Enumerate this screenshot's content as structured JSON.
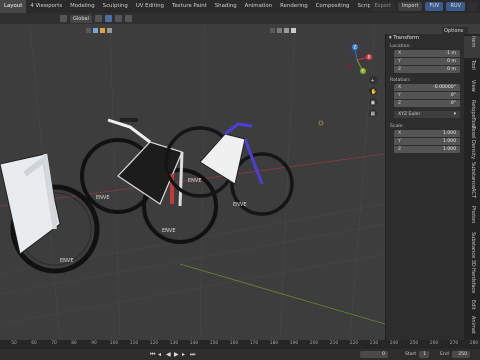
{
  "workspace_tabs": [
    {
      "label": "Layout",
      "active": true
    },
    {
      "label": "4 Viewports",
      "active": false
    },
    {
      "label": "Modeling",
      "active": false
    },
    {
      "label": "Sculpting",
      "active": false
    },
    {
      "label": "UV Editing",
      "active": false
    },
    {
      "label": "Texture Paint",
      "active": false
    },
    {
      "label": "Shading",
      "active": false
    },
    {
      "label": "Animation",
      "active": false
    },
    {
      "label": "Rendering",
      "active": false
    },
    {
      "label": "Compositing",
      "active": false
    },
    {
      "label": "Scripting",
      "active": false
    }
  ],
  "topbar_right": {
    "export": "Export",
    "import": "Import",
    "fuv": "FUV",
    "ruv": "RUV"
  },
  "viewport_header": {
    "orientation": "Global"
  },
  "options_label": "Options",
  "transform_panel": {
    "title": "Transform",
    "location_label": "Location:",
    "location": [
      {
        "axis": "X",
        "value": "-1 m"
      },
      {
        "axis": "Y",
        "value": "0 m"
      },
      {
        "axis": "Z",
        "value": "0 m"
      }
    ],
    "rotation_label": "Rotation:",
    "rotation": [
      {
        "axis": "X",
        "value": "-0.00000°"
      },
      {
        "axis": "Y",
        "value": "0°"
      },
      {
        "axis": "Z",
        "value": "0°"
      }
    ],
    "rotation_mode": "XYZ Euler",
    "scale_label": "Scale:",
    "scale": [
      {
        "axis": "X",
        "value": "1.000"
      },
      {
        "axis": "Y",
        "value": "1.000"
      },
      {
        "axis": "Z",
        "value": "1.000"
      }
    ]
  },
  "side_tabs": [
    "Item",
    "Tool",
    "View",
    "Retopoflow",
    "Texel Density",
    "Substance",
    "ACT",
    "Photon",
    "Substance 3D",
    "Hardsface",
    "Edit",
    "Animat"
  ],
  "timeline": {
    "ticks": [
      "50",
      "60",
      "70",
      "80",
      "90",
      "100",
      "110",
      "120",
      "130",
      "140",
      "150",
      "160",
      "170",
      "180",
      "190",
      "200",
      "210",
      "220",
      "230",
      "240",
      "250",
      "260",
      "270",
      "280"
    ],
    "current_frame": "0",
    "start_label": "Start",
    "start": "1",
    "end_label": "End",
    "end": "250"
  },
  "colors": {
    "accent": "#4772b3",
    "x_axis": "#d93f49",
    "y_axis": "#7fb32a",
    "z_axis": "#3f7fd9"
  }
}
